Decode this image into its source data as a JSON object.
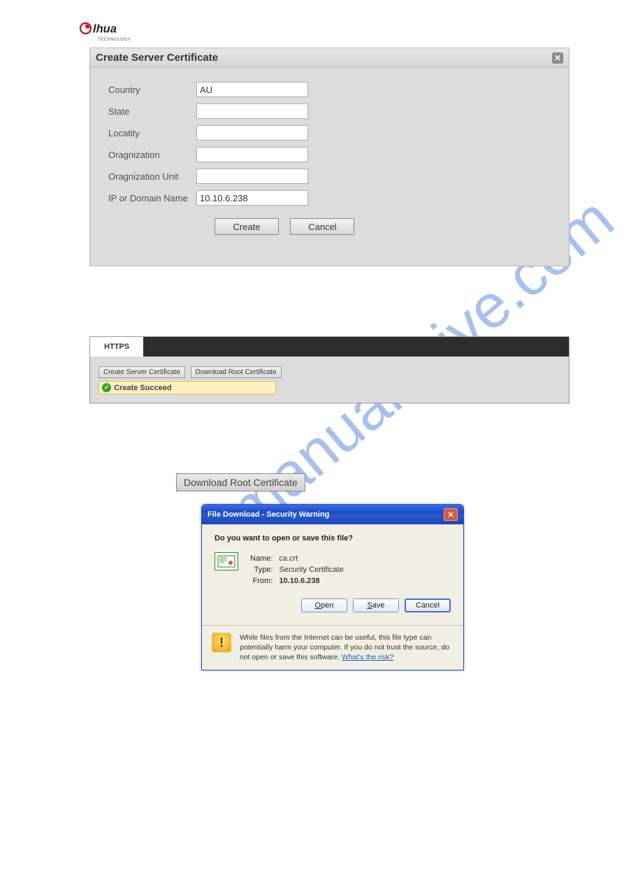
{
  "logo": {
    "brand": "alhua",
    "sub": "TECHNOLOGY"
  },
  "watermark": "manualshive.com",
  "dialog": {
    "title": "Create Server Certificate",
    "fields": {
      "country_label": "Country",
      "country_value": "AU",
      "state_label": "State",
      "state_value": "",
      "locality_label": "Locatity",
      "locality_value": "",
      "org_label": "Oragnization",
      "org_value": "",
      "orgunit_label": "Oragnization Unit",
      "orgunit_value": "",
      "ip_label": "IP or Domain Name",
      "ip_value": "10.10.6.238"
    },
    "buttons": {
      "create": "Create",
      "cancel": "Cancel"
    }
  },
  "https_panel": {
    "tab_label": "HTTPS",
    "btn_create": "Create Server Certificate",
    "btn_download": "Download Root Certificate",
    "success_msg": "Create Succeed"
  },
  "download_btn": "Download Root Certificate",
  "xp_dialog": {
    "title": "File Download - Security Warning",
    "question": "Do you want to open or save this file?",
    "name_label": "Name:",
    "name_value": "ca.crt",
    "type_label": "Type:",
    "type_value": "Security Certificate",
    "from_label": "From:",
    "from_value": "10.10.6.238",
    "btn_open": "Open",
    "btn_save": "Save",
    "btn_cancel": "Cancel",
    "warning_text_1": "While files from the Internet can be useful, this file type can potentially harm your computer. If you do not trust the source, do not open or save this software. ",
    "risk_link": "What's the risk?"
  }
}
